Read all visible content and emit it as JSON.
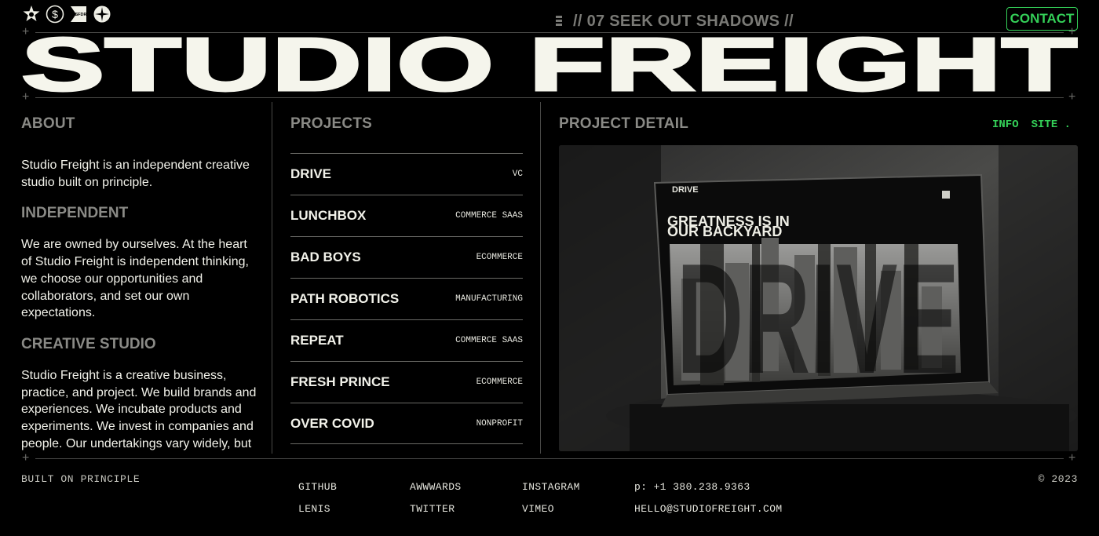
{
  "header": {
    "logos": [
      "star-badge-icon",
      "dollar-badge-icon",
      "sfdr-badge-icon",
      "compass-star-icon"
    ],
    "sfdr_logo_text": "SFDR",
    "marquee": "// 07 SEEK OUT SHADOWS //",
    "contact_label": "CONTACT"
  },
  "hero": {
    "title": "STUDIO FREIGHT"
  },
  "about": {
    "heading": "ABOUT",
    "intro": "Studio Freight is an independent creative studio built on principle.",
    "sections": [
      {
        "title": "INDEPENDENT",
        "text": "We are owned by ourselves. At the heart of Studio Freight is independent thinking, we choose our opportunities and collaborators, and set our own expectations."
      },
      {
        "title": "CREATIVE STUDIO",
        "text": "Studio Freight is a creative business, practice, and project. We build brands and experiences. We incubate products and experiments. We invest in companies and people. Our undertakings vary widely, but"
      }
    ]
  },
  "projects": {
    "heading": "PROJECTS",
    "items": [
      {
        "name": "DRIVE",
        "tag": "VC"
      },
      {
        "name": "LUNCHBOX",
        "tag": "COMMERCE SAAS"
      },
      {
        "name": "BAD BOYS",
        "tag": "ECOMMERCE"
      },
      {
        "name": "PATH ROBOTICS",
        "tag": "MANUFACTURING"
      },
      {
        "name": "REPEAT",
        "tag": "COMMERCE SAAS"
      },
      {
        "name": "FRESH PRINCE",
        "tag": "ECOMMERCE"
      },
      {
        "name": "OVER COVID",
        "tag": "NONPROFIT"
      }
    ]
  },
  "detail": {
    "heading": "PROJECT DETAIL",
    "info_label": "INFO",
    "site_label": "SITE .",
    "screen_brand": "DRIVE",
    "screen_headline_1": "GREATNESS IS IN",
    "screen_headline_2": "OUR BACKYARD",
    "screen_big_word": "DRIVE"
  },
  "footer": {
    "tagline": "BUILT ON PRINCIPLE",
    "links": {
      "github": "GITHUB",
      "awwwards": "AWWWARDS",
      "instagram": "INSTAGRAM",
      "lenis": "LENIS",
      "twitter": "TWITTER",
      "vimeo": "VIMEO"
    },
    "phone": "p: +1 380.238.9363",
    "email": "HELLO@STUDIOFREIGHT.COM",
    "copyright": "© 2023"
  },
  "colors": {
    "accent": "#34d058",
    "background": "#000000",
    "text": "#efefe6",
    "muted": "#8a8a86"
  }
}
